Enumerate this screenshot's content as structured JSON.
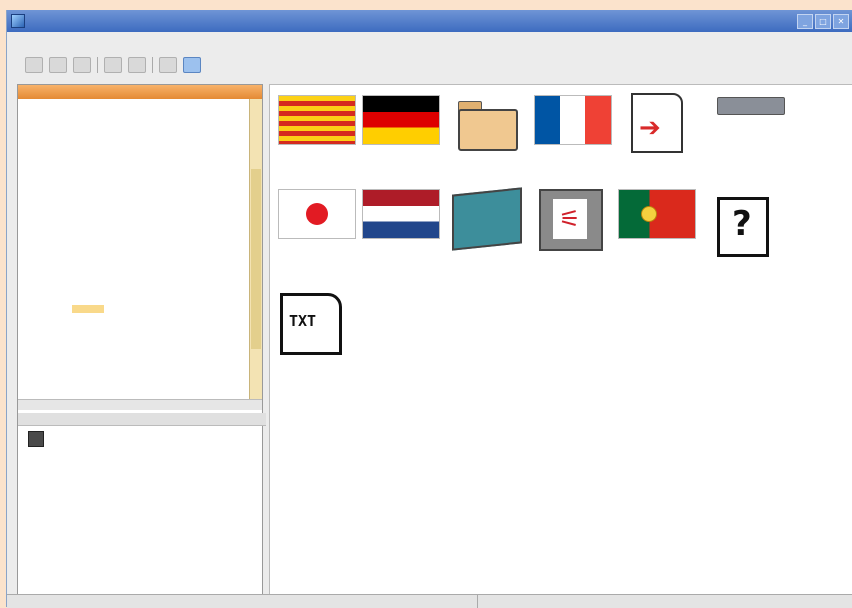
{
  "window": {
    "title": "",
    "buttons": [
      "_",
      "□",
      "✕"
    ]
  },
  "menu": [
    "",
    "",
    "",
    ""
  ],
  "tree": {
    "header": "",
    "rows": [
      {
        "label": "",
        "indent": 0
      },
      {
        "label": "",
        "indent": 1
      },
      {
        "label": "",
        "indent": 1
      },
      {
        "label": "",
        "indent": 2
      },
      {
        "label": "",
        "indent": 3
      },
      {
        "label": "",
        "indent": 3
      },
      {
        "label": "",
        "indent": 3
      },
      {
        "label": "",
        "indent": 3
      },
      {
        "label": "",
        "indent": 3
      },
      {
        "label": "",
        "indent": 3
      },
      {
        "label": "",
        "indent": 3
      },
      {
        "label": "",
        "indent": 3
      },
      {
        "label": "",
        "indent": 3
      },
      {
        "label": "",
        "indent": 3
      },
      {
        "label": "",
        "indent": 3
      },
      {
        "label": "",
        "indent": 3
      },
      {
        "label": "",
        "indent": 4
      },
      {
        "label": "",
        "indent": 4,
        "selected": true
      },
      {
        "label": "",
        "indent": 3
      },
      {
        "label": "",
        "indent": 3
      }
    ]
  },
  "properties": {
    "header": ""
  },
  "files": [
    {
      "name": "",
      "icon": "catalonia-flag-icon"
    },
    {
      "name": "",
      "icon": "germany-flag-icon"
    },
    {
      "name": "",
      "icon": "folder-icon"
    },
    {
      "name": "",
      "icon": "france-flag-icon"
    },
    {
      "name": "",
      "icon": "export-document-icon"
    },
    {
      "name": "",
      "icon": "drive-icon"
    },
    {
      "name": "",
      "icon": "japan-flag-icon"
    },
    {
      "name": "",
      "icon": "netherlands-flag-icon"
    },
    {
      "name": "",
      "icon": "dumpster-icon"
    },
    {
      "name": "",
      "icon": "pdf-icon"
    },
    {
      "name": "",
      "icon": "portugal-flag-icon"
    },
    {
      "name": "",
      "icon": "unknown-file-icon"
    },
    {
      "name": "",
      "icon": "txt-file-icon"
    }
  ],
  "status": {
    "left": "",
    "middle": "",
    "right": ""
  },
  "icons": {
    "pdf_glyph": "⚟",
    "txt_glyph": "TXT"
  }
}
